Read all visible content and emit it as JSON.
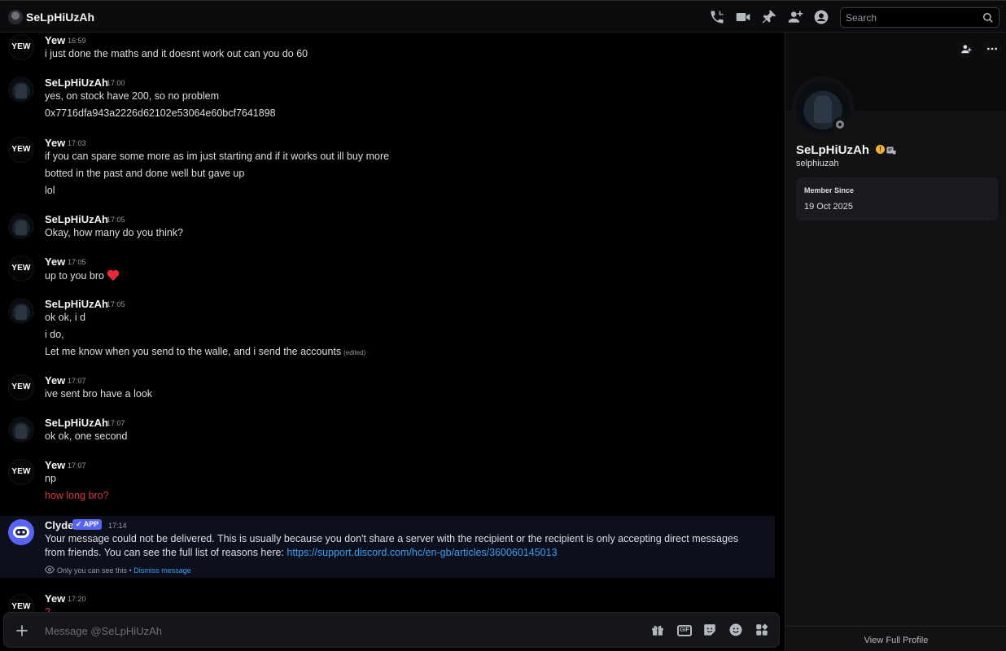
{
  "header": {
    "title": "SeLpHiUzAh",
    "search_placeholder": "Search"
  },
  "messages": [
    {
      "author": "Yew",
      "avatar_text": "YEW",
      "time": "16:59",
      "lines": [
        "i just done the maths and it doesnt work out can you do 60"
      ]
    },
    {
      "author": "SeLpHiUzAh",
      "time": "17:00",
      "lines": [
        "yes, on stock have 200, so no problem",
        "0x7716dfa943a2226d62102e53064e60bcf7641898"
      ]
    },
    {
      "author": "Yew",
      "avatar_text": "YEW",
      "time": "17:03",
      "lines": [
        "if you can spare some more as im just starting and if it works out ill buy more",
        "botted in the past and done well but gave up",
        "lol"
      ]
    },
    {
      "author": "SeLpHiUzAh",
      "time": "17:05",
      "lines": [
        "Okay, how many do you think?"
      ]
    },
    {
      "author": "Yew",
      "avatar_text": "YEW",
      "time": "17:05",
      "lines": [
        "up to you bro"
      ]
    },
    {
      "author": "SeLpHiUzAh",
      "time": "17:05",
      "lines": [
        "ok ok, i d",
        "i do,",
        "Let me know when you send to the walle, and i send the accounts"
      ],
      "edited": "(edited)"
    },
    {
      "author": "Yew",
      "avatar_text": "YEW",
      "time": "17:07",
      "lines": [
        "ive sent bro have a look"
      ]
    },
    {
      "author": "SeLpHiUzAh",
      "time": "17:07",
      "lines": [
        "ok ok, one second"
      ]
    },
    {
      "author": "Yew",
      "avatar_text": "YEW",
      "time": "17:07",
      "lines": [
        "np",
        "how long bro?"
      ]
    },
    {
      "author": "Clyde",
      "badge": "APP",
      "time": "17:14",
      "text": "Your message could not be delivered. This is usually because you don't share a server with the recipient or the recipient is only accepting direct messages from friends. You can see the full list of reasons here: ",
      "link": "https://support.discord.com/hc/en-gb/articles/360060145013",
      "only_you": "Only you can see this",
      "separator": " • ",
      "dismiss": "Dismiss message"
    },
    {
      "author": "Yew",
      "avatar_text": "YEW",
      "time": "17:20",
      "lines": [
        "?"
      ]
    }
  ],
  "composer": {
    "placeholder": "Message @SeLpHiUzAh",
    "gif_label": "GIF"
  },
  "profile": {
    "display_name": "SeLpHiUzAh",
    "username": "selphiuzah",
    "warning_badge": "!",
    "member_since_label": "Member Since",
    "member_since_date": "19 Oct 2025",
    "view_full_profile": "View Full Profile"
  },
  "colors": {
    "accent": "#5865f2",
    "link": "#3aa0f3",
    "failed_message": "#d83c3e",
    "heart": "#e62a3a"
  },
  "icons": [
    "voice-call-icon",
    "video-call-icon",
    "pin-icon",
    "add-friends-icon",
    "user-profile-icon",
    "search-icon",
    "plus-icon",
    "gift-icon",
    "gif-icon",
    "sticker-icon",
    "emoji-icon",
    "apps-icon",
    "add-friend-icon",
    "more-icon",
    "heart-emoji",
    "eye-icon"
  ]
}
